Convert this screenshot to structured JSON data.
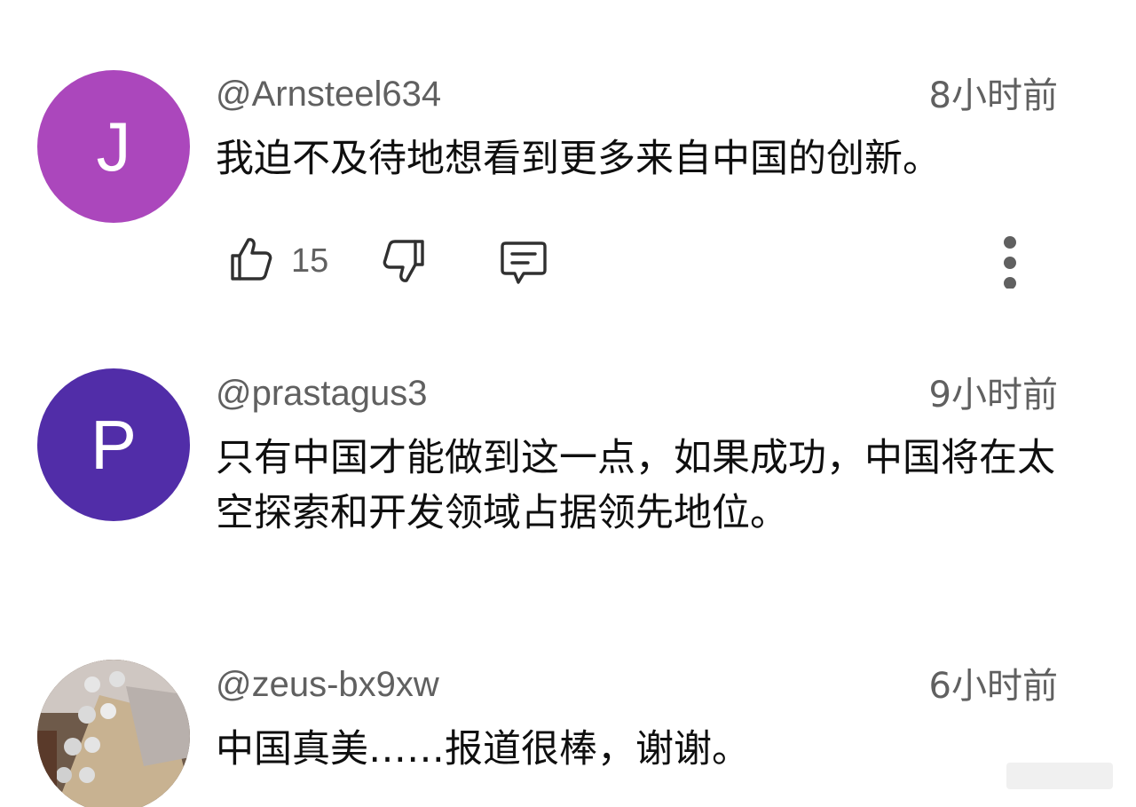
{
  "comments": [
    {
      "avatar_letter": "J",
      "avatar_color": "#ab47bc",
      "handle": "@Arnsteel634",
      "time": "8小时前",
      "text": "我迫不及待地想看到更多来自中国的创新。",
      "likes": "15"
    },
    {
      "avatar_letter": "P",
      "avatar_color": "#512da8",
      "handle": "@prastagus3",
      "time": "9小时前",
      "text": "只有中国才能做到这一点，如果成功，中国将在太空探索和开发领域占据领先地位。"
    },
    {
      "avatar_letter": "",
      "avatar_color": "#8a7a6a",
      "handle": "@zeus-bx9xw",
      "time": "6小时前",
      "text": "中国真美……报道很棒，谢谢。"
    }
  ],
  "icons": {
    "like": "thumb-up-icon",
    "dislike": "thumb-down-icon",
    "reply": "reply-comment-icon",
    "more": "more-vertical-icon"
  }
}
